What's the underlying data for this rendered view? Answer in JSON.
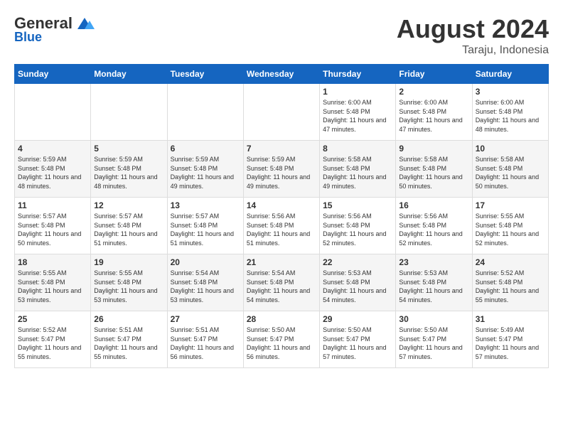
{
  "header": {
    "logo_general": "General",
    "logo_blue": "Blue",
    "month_year": "August 2024",
    "location": "Taraju, Indonesia"
  },
  "weekdays": [
    "Sunday",
    "Monday",
    "Tuesday",
    "Wednesday",
    "Thursday",
    "Friday",
    "Saturday"
  ],
  "weeks": [
    [
      {
        "day": "",
        "info": ""
      },
      {
        "day": "",
        "info": ""
      },
      {
        "day": "",
        "info": ""
      },
      {
        "day": "",
        "info": ""
      },
      {
        "day": "1",
        "info": "Sunrise: 6:00 AM\nSunset: 5:48 PM\nDaylight: 11 hours and 47 minutes."
      },
      {
        "day": "2",
        "info": "Sunrise: 6:00 AM\nSunset: 5:48 PM\nDaylight: 11 hours and 47 minutes."
      },
      {
        "day": "3",
        "info": "Sunrise: 6:00 AM\nSunset: 5:48 PM\nDaylight: 11 hours and 48 minutes."
      }
    ],
    [
      {
        "day": "4",
        "info": "Sunrise: 5:59 AM\nSunset: 5:48 PM\nDaylight: 11 hours and 48 minutes."
      },
      {
        "day": "5",
        "info": "Sunrise: 5:59 AM\nSunset: 5:48 PM\nDaylight: 11 hours and 48 minutes."
      },
      {
        "day": "6",
        "info": "Sunrise: 5:59 AM\nSunset: 5:48 PM\nDaylight: 11 hours and 49 minutes."
      },
      {
        "day": "7",
        "info": "Sunrise: 5:59 AM\nSunset: 5:48 PM\nDaylight: 11 hours and 49 minutes."
      },
      {
        "day": "8",
        "info": "Sunrise: 5:58 AM\nSunset: 5:48 PM\nDaylight: 11 hours and 49 minutes."
      },
      {
        "day": "9",
        "info": "Sunrise: 5:58 AM\nSunset: 5:48 PM\nDaylight: 11 hours and 50 minutes."
      },
      {
        "day": "10",
        "info": "Sunrise: 5:58 AM\nSunset: 5:48 PM\nDaylight: 11 hours and 50 minutes."
      }
    ],
    [
      {
        "day": "11",
        "info": "Sunrise: 5:57 AM\nSunset: 5:48 PM\nDaylight: 11 hours and 50 minutes."
      },
      {
        "day": "12",
        "info": "Sunrise: 5:57 AM\nSunset: 5:48 PM\nDaylight: 11 hours and 51 minutes."
      },
      {
        "day": "13",
        "info": "Sunrise: 5:57 AM\nSunset: 5:48 PM\nDaylight: 11 hours and 51 minutes."
      },
      {
        "day": "14",
        "info": "Sunrise: 5:56 AM\nSunset: 5:48 PM\nDaylight: 11 hours and 51 minutes."
      },
      {
        "day": "15",
        "info": "Sunrise: 5:56 AM\nSunset: 5:48 PM\nDaylight: 11 hours and 52 minutes."
      },
      {
        "day": "16",
        "info": "Sunrise: 5:56 AM\nSunset: 5:48 PM\nDaylight: 11 hours and 52 minutes."
      },
      {
        "day": "17",
        "info": "Sunrise: 5:55 AM\nSunset: 5:48 PM\nDaylight: 11 hours and 52 minutes."
      }
    ],
    [
      {
        "day": "18",
        "info": "Sunrise: 5:55 AM\nSunset: 5:48 PM\nDaylight: 11 hours and 53 minutes."
      },
      {
        "day": "19",
        "info": "Sunrise: 5:55 AM\nSunset: 5:48 PM\nDaylight: 11 hours and 53 minutes."
      },
      {
        "day": "20",
        "info": "Sunrise: 5:54 AM\nSunset: 5:48 PM\nDaylight: 11 hours and 53 minutes."
      },
      {
        "day": "21",
        "info": "Sunrise: 5:54 AM\nSunset: 5:48 PM\nDaylight: 11 hours and 54 minutes."
      },
      {
        "day": "22",
        "info": "Sunrise: 5:53 AM\nSunset: 5:48 PM\nDaylight: 11 hours and 54 minutes."
      },
      {
        "day": "23",
        "info": "Sunrise: 5:53 AM\nSunset: 5:48 PM\nDaylight: 11 hours and 54 minutes."
      },
      {
        "day": "24",
        "info": "Sunrise: 5:52 AM\nSunset: 5:48 PM\nDaylight: 11 hours and 55 minutes."
      }
    ],
    [
      {
        "day": "25",
        "info": "Sunrise: 5:52 AM\nSunset: 5:47 PM\nDaylight: 11 hours and 55 minutes."
      },
      {
        "day": "26",
        "info": "Sunrise: 5:51 AM\nSunset: 5:47 PM\nDaylight: 11 hours and 55 minutes."
      },
      {
        "day": "27",
        "info": "Sunrise: 5:51 AM\nSunset: 5:47 PM\nDaylight: 11 hours and 56 minutes."
      },
      {
        "day": "28",
        "info": "Sunrise: 5:50 AM\nSunset: 5:47 PM\nDaylight: 11 hours and 56 minutes."
      },
      {
        "day": "29",
        "info": "Sunrise: 5:50 AM\nSunset: 5:47 PM\nDaylight: 11 hours and 57 minutes."
      },
      {
        "day": "30",
        "info": "Sunrise: 5:50 AM\nSunset: 5:47 PM\nDaylight: 11 hours and 57 minutes."
      },
      {
        "day": "31",
        "info": "Sunrise: 5:49 AM\nSunset: 5:47 PM\nDaylight: 11 hours and 57 minutes."
      }
    ]
  ]
}
